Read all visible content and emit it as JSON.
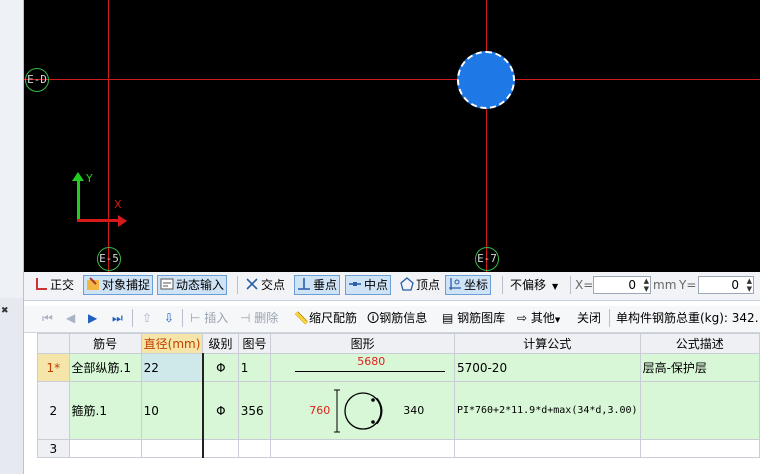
{
  "canvas": {
    "axis_labels": {
      "top_left": "E-D",
      "bottom_left": "E-5",
      "bottom_right": "E-7"
    },
    "ucs": {
      "y_label": "Y",
      "x_label": "X"
    },
    "colors": {
      "background": "#000000",
      "axis_line": "#d11a1a",
      "column_fill": "#1e78e6",
      "bubble": "#3bb84a"
    }
  },
  "snap_toolbar": {
    "ortho": "正交",
    "object_snap": "对象捕捉",
    "dynamic_input": "动态输入",
    "intersection": "交点",
    "perpendicular": "垂点",
    "midpoint": "中点",
    "vertex": "顶点",
    "coordinate": "坐标",
    "offset_mode": "不偏移",
    "x_label": "X=",
    "x_value": "0",
    "unit1": "mm",
    "y_label": "Y=",
    "y_value": "0"
  },
  "rebar_toolbar": {
    "insert": "插入",
    "delete": "删除",
    "scale_rebar": "缩尺配筋",
    "rebar_info": "钢筋信息",
    "rebar_library": "钢筋图库",
    "other": "其他",
    "close": "关闭",
    "total_weight": "单构件钢筋总重(kg): 342."
  },
  "table": {
    "headers": [
      "筋号",
      "直径(mm)",
      "级别",
      "图号",
      "图形",
      "计算公式",
      "公式描述"
    ],
    "rows": [
      {
        "num": "1*",
        "name": "全部纵筋.1",
        "diameter": "22",
        "grade": "Φ",
        "figure_no": "1",
        "shape_value": "5680",
        "formula": "5700-20",
        "description": "层高-保护层"
      },
      {
        "num": "2",
        "name": "箍筋.1",
        "diameter": "10",
        "grade": "Φ",
        "figure_no": "356",
        "shape_dim1": "760",
        "shape_dim2": "340",
        "formula": "PI*760+2*11.9*d+max(34*d,3.00)",
        "description": ""
      },
      {
        "num": "3",
        "name": "",
        "diameter": "",
        "grade": "",
        "figure_no": "",
        "formula": "",
        "description": ""
      }
    ]
  }
}
